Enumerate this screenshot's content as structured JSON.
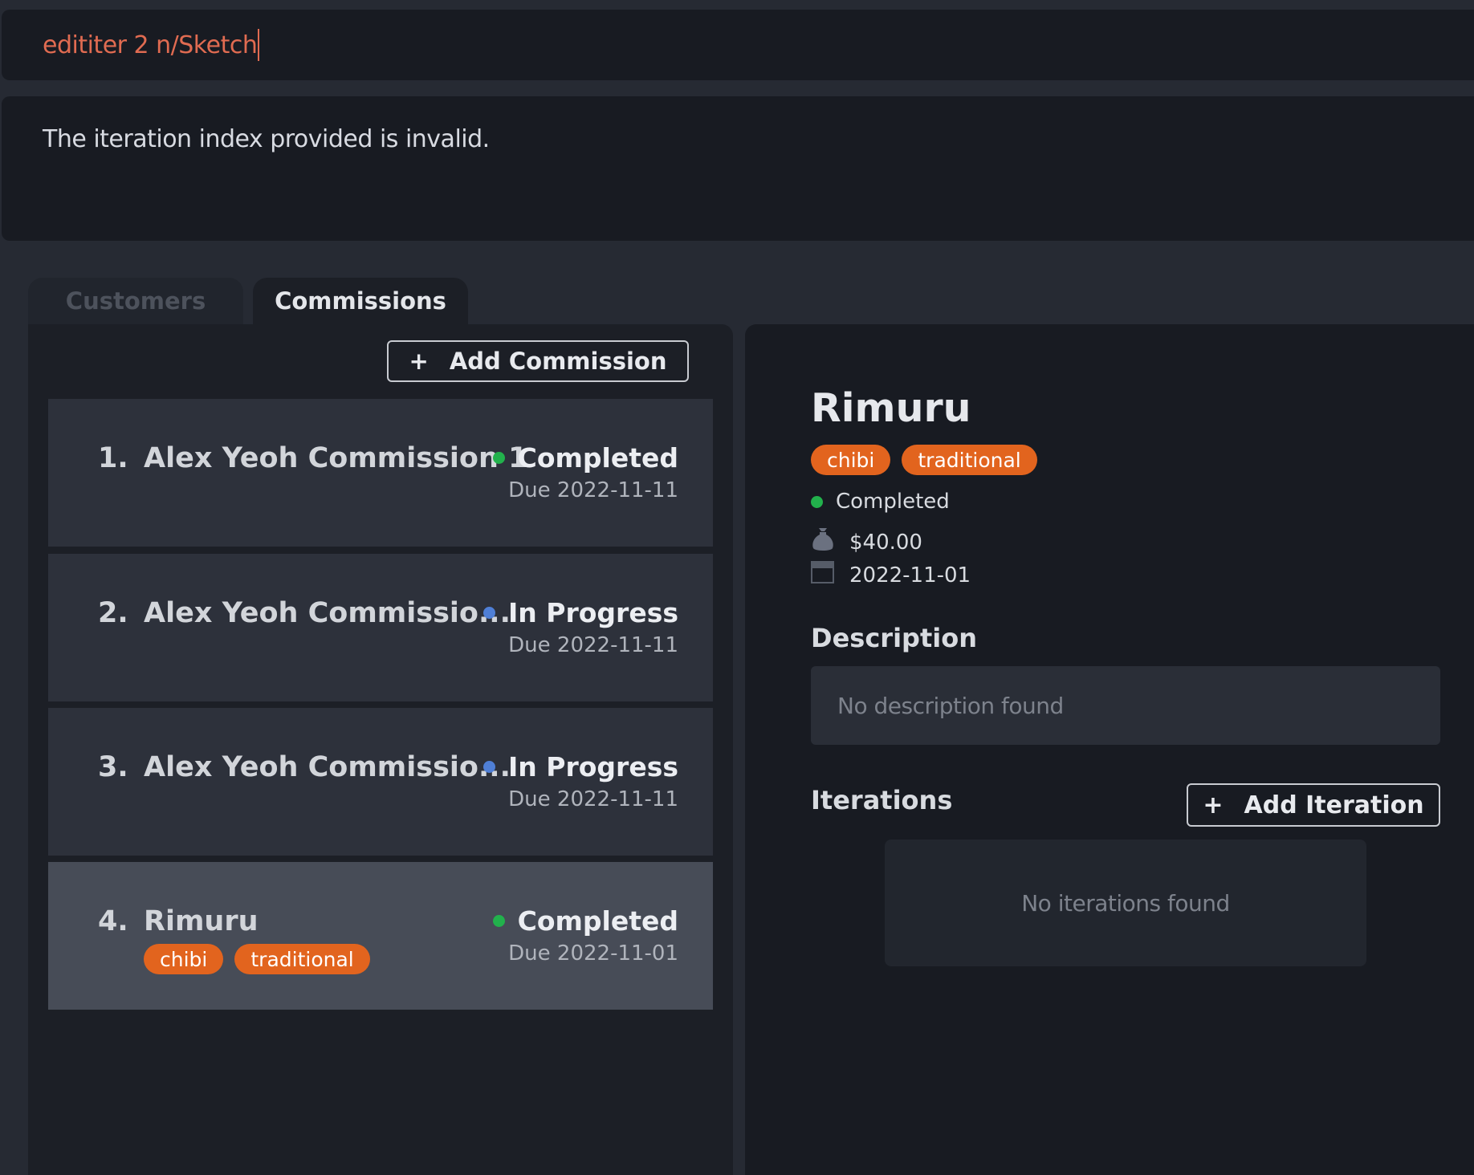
{
  "command_box": {
    "value": "edititer 2 n/Sketch"
  },
  "result_display": {
    "message": "The iteration index provided is invalid."
  },
  "tabs": [
    {
      "label": "Customers",
      "active": false
    },
    {
      "label": "Commissions",
      "active": true
    }
  ],
  "list_toolbar": {
    "add_label": "Add Commission",
    "add_icon": "plus-icon"
  },
  "commissions": [
    {
      "index": "1.",
      "title": "Alex Yeoh Commission 1",
      "status": "Completed",
      "status_color": "#22b14c",
      "due": "Due 2022-11-11",
      "tags": []
    },
    {
      "index": "2.",
      "title": "Alex Yeoh Commissio...",
      "status": "In Progress",
      "status_color": "#4f7fd6",
      "due": "Due 2022-11-11",
      "tags": []
    },
    {
      "index": "3.",
      "title": "Alex Yeoh Commissio...",
      "status": "In Progress",
      "status_color": "#4f7fd6",
      "due": "Due 2022-11-11",
      "tags": []
    },
    {
      "index": "4.",
      "title": "Rimuru",
      "status": "Completed",
      "status_color": "#22b14c",
      "due": "Due 2022-11-01",
      "tags": [
        "chibi",
        "traditional"
      ],
      "selected": true
    }
  ],
  "detail": {
    "title": "Rimuru",
    "tags": [
      "chibi",
      "traditional"
    ],
    "status": "Completed",
    "status_color": "#22b14c",
    "fee": "$40.00",
    "fee_icon": "money-bag-icon",
    "date": "2022-11-01",
    "date_icon": "calendar-icon",
    "description_heading": "Description",
    "description_placeholder": "No description found",
    "iterations_heading": "Iterations",
    "add_iteration_label": "Add Iteration",
    "iterations_placeholder": "No iterations found"
  },
  "colors": {
    "accent_tag": "#e2641e",
    "command_text": "#e06b51",
    "background": "#262a33"
  }
}
